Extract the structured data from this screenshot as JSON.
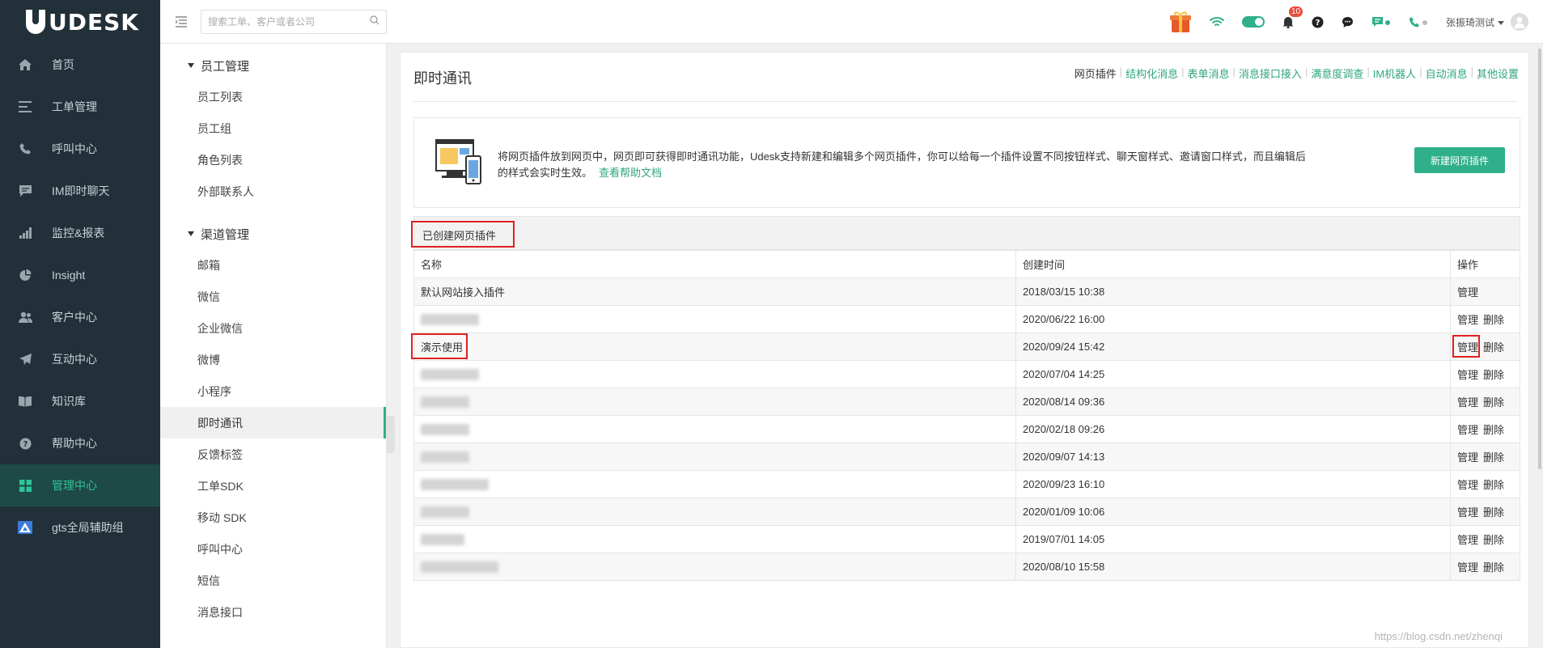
{
  "sidebar": {
    "logo": "UDESK",
    "items": [
      {
        "label": "首页",
        "icon": "home-icon"
      },
      {
        "label": "工单管理",
        "icon": "list-icon"
      },
      {
        "label": "呼叫中心",
        "icon": "phone-icon"
      },
      {
        "label": "IM即时聊天",
        "icon": "chat-icon"
      },
      {
        "label": "监控&报表",
        "icon": "bar-chart-icon"
      },
      {
        "label": "Insight",
        "icon": "pie-icon"
      },
      {
        "label": "客户中心",
        "icon": "users-icon"
      },
      {
        "label": "互动中心",
        "icon": "send-icon"
      },
      {
        "label": "知识库",
        "icon": "book-icon"
      },
      {
        "label": "帮助中心",
        "icon": "help-icon"
      },
      {
        "label": "管理中心",
        "icon": "grid-icon",
        "active": true
      },
      {
        "label": "gts全局辅助组",
        "icon": "triangle-logo-icon"
      }
    ]
  },
  "header": {
    "search_placeholder": "搜索工单、客户或者公司",
    "notification_count": "10",
    "user_name": "张振琦测试"
  },
  "submenu": {
    "groups": [
      {
        "title": "员工管理",
        "items": [
          "员工列表",
          "员工组",
          "角色列表",
          "外部联系人"
        ]
      },
      {
        "title": "渠道管理",
        "items": [
          "邮箱",
          "微信",
          "企业微信",
          "微博",
          "小程序",
          "即时通讯",
          "反馈标签",
          "工单SDK",
          "移动 SDK",
          "呼叫中心",
          "短信",
          "消息接口"
        ]
      }
    ],
    "active_item": "即时通讯"
  },
  "main": {
    "title": "即时通讯",
    "top_links": [
      "网页插件",
      "结构化消息",
      "表单消息",
      "消息接口接入",
      "满意度调查",
      "IM机器人",
      "自动消息",
      "其他设置"
    ],
    "intro_text": "将网页插件放到网页中，网页即可获得即时通讯功能，Udesk支持新建和编辑多个网页插件，你可以给每一个插件设置不同按钮样式、聊天窗样式、邀请窗口样式，而且编辑后的样式会实时生效。",
    "help_link": "查看帮助文档",
    "new_button": "新建网页插件",
    "list_title": "已创建网页插件",
    "table": {
      "headers": [
        "名称",
        "创建时间",
        "操作"
      ],
      "rows": [
        {
          "name": "默认网站接入插件",
          "time": "2018/03/15 10:38",
          "actions": [
            "管理"
          ]
        },
        {
          "name": "",
          "time": "2020/06/22 16:00",
          "actions": [
            "管理",
            "删除"
          ]
        },
        {
          "name": "演示使用",
          "time": "2020/09/24 15:42",
          "actions": [
            "管理",
            "删除"
          ]
        },
        {
          "name": "",
          "time": "2020/07/04 14:25",
          "actions": [
            "管理",
            "删除"
          ]
        },
        {
          "name": "",
          "time": "2020/08/14 09:36",
          "actions": [
            "管理",
            "删除"
          ]
        },
        {
          "name": "",
          "time": "2020/02/18 09:26",
          "actions": [
            "管理",
            "删除"
          ]
        },
        {
          "name": "",
          "time": "2020/09/07 14:13",
          "actions": [
            "管理",
            "删除"
          ]
        },
        {
          "name": "",
          "time": "2020/09/23 16:10",
          "actions": [
            "管理",
            "删除"
          ]
        },
        {
          "name": "",
          "time": "2020/01/09 10:06",
          "actions": [
            "管理",
            "删除"
          ]
        },
        {
          "name": "",
          "time": "2019/07/01 14:05",
          "actions": [
            "管理",
            "删除"
          ]
        },
        {
          "name": "",
          "time": "2020/08/10 15:58",
          "actions": [
            "管理",
            "删除"
          ]
        }
      ]
    }
  },
  "watermark": "https://blog.csdn.net/zhenqi",
  "colors": {
    "accent": "#2fb08a",
    "sidebar_bg": "#223039",
    "highlight": "#e02020"
  }
}
